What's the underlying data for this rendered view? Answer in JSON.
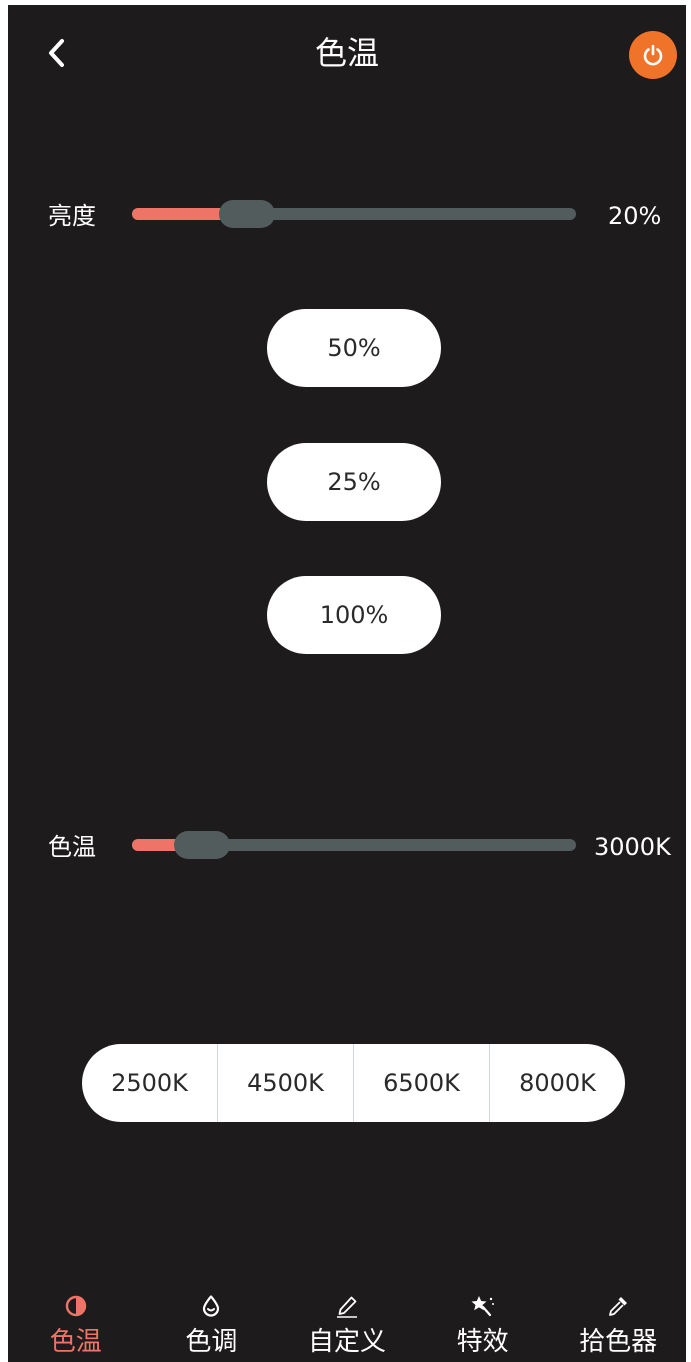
{
  "header": {
    "title": "色温"
  },
  "brightness": {
    "label": "亮度",
    "value": "20%",
    "level": 0.2
  },
  "presets": [
    "50%",
    "25%",
    "100%"
  ],
  "color_temp": {
    "label": "色温",
    "value": "3000K",
    "level": 0.1
  },
  "temp_options": [
    "2500K",
    "4500K",
    "6500K",
    "8000K"
  ],
  "bottom_nav": [
    {
      "label": "色温",
      "icon": "contrast-icon",
      "active": true
    },
    {
      "label": "色调",
      "icon": "droplet-icon",
      "active": false
    },
    {
      "label": "自定义",
      "icon": "pencil-icon",
      "active": false
    },
    {
      "label": "特效",
      "icon": "magic-wand-icon",
      "active": false
    },
    {
      "label": "拾色器",
      "icon": "eyedropper-icon",
      "active": false
    }
  ],
  "colors": {
    "background": "#1e1b1c",
    "accent": "#ee7468",
    "power": "#f0732a",
    "track": "#535c5d"
  }
}
